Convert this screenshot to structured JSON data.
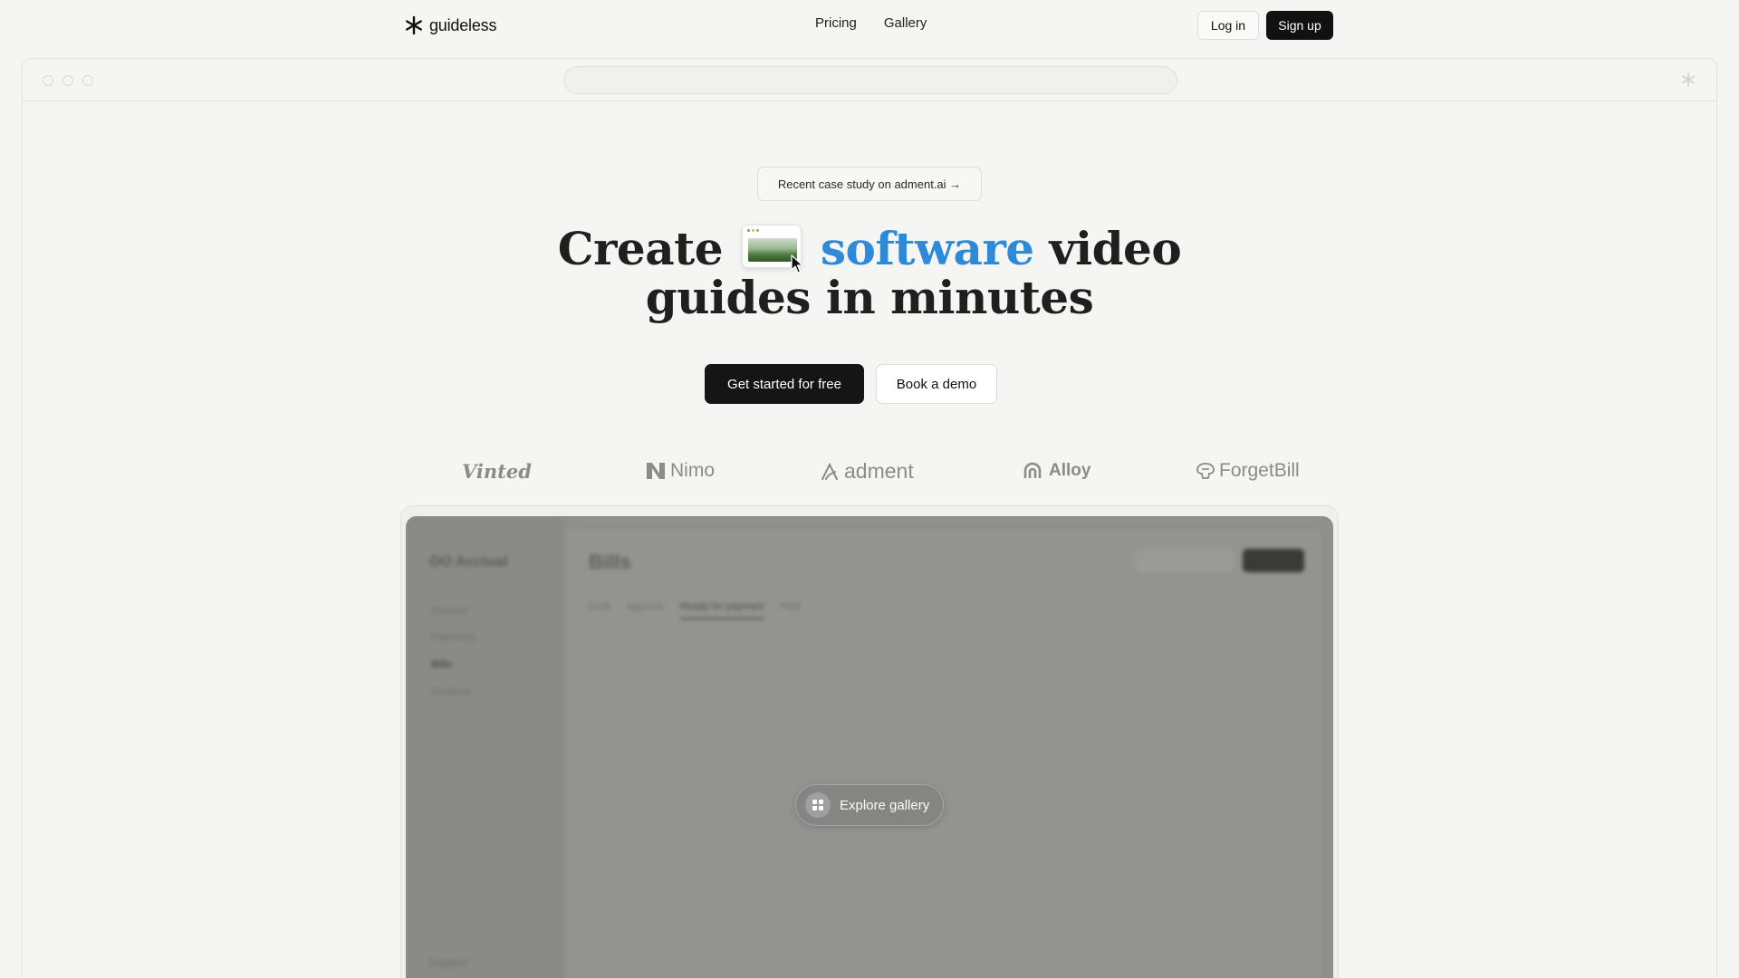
{
  "nav": {
    "logo_text": "guideless",
    "links": [
      "Pricing",
      "Gallery"
    ],
    "login_label": "Log in",
    "signup_label": "Sign up"
  },
  "hero": {
    "badge": "Recent case study on adment.ai →",
    "headline_pre": "Create",
    "headline_accent": "software",
    "headline_post": "video",
    "headline_line2": "guides in minutes",
    "cta_primary": "Get started for free",
    "cta_secondary": "Book a demo"
  },
  "logos": [
    "Vinted",
    "Nimo",
    "adment",
    "Alloy",
    "ForgetBill"
  ],
  "preview": {
    "app_name": "OO Acctual",
    "sidebar": [
      "Invoices",
      "Payments",
      "Bills",
      "Contacts"
    ],
    "support": "Support",
    "title": "Bills",
    "tabs": [
      "Draft",
      "Approve",
      "Ready for payment",
      "Paid"
    ],
    "explore_label": "Explore gallery"
  },
  "colors": {
    "accent": "#2e8ad8",
    "primary_button": "#151515",
    "background": "#f5f5f3"
  }
}
